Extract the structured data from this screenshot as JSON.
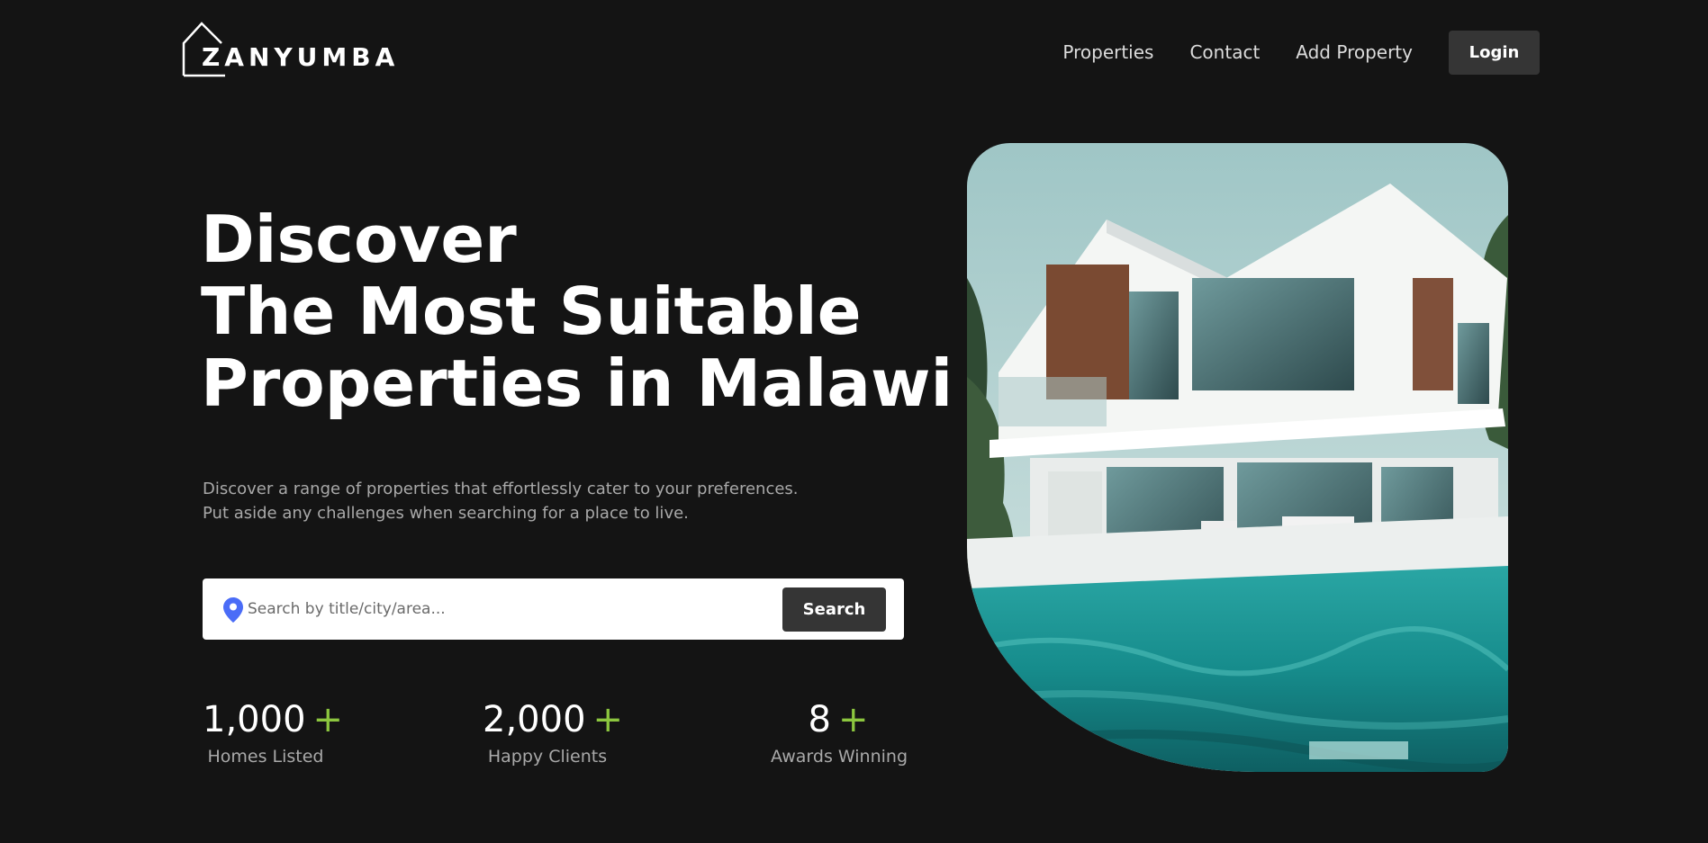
{
  "header": {
    "brand": "ZANYUMBA",
    "nav": {
      "properties": "Properties",
      "contact": "Contact",
      "add_property": "Add Property",
      "login": "Login"
    }
  },
  "hero": {
    "title_lines": [
      "Discover",
      "The Most Suitable",
      "Properties in Malawi"
    ],
    "description_lines": [
      "Discover a range of properties that effortlessly cater to your preferences.",
      "Put aside any challenges when searching for a place to live."
    ],
    "search": {
      "placeholder": "Search by title/city/area...",
      "value": "",
      "button": "Search",
      "icon": "location-pin-icon"
    },
    "stats": [
      {
        "value": "1,000",
        "suffix": "+",
        "label": "Homes Listed"
      },
      {
        "value": "2,000",
        "suffix": "+",
        "label": "Happy Clients"
      },
      {
        "value": "8",
        "suffix": "+",
        "label": "Awards Winning"
      }
    ]
  },
  "colors": {
    "background": "#141414",
    "accent_green": "#8cc63f",
    "button_dark": "#353535",
    "pin_blue": "#4a6cf7"
  }
}
